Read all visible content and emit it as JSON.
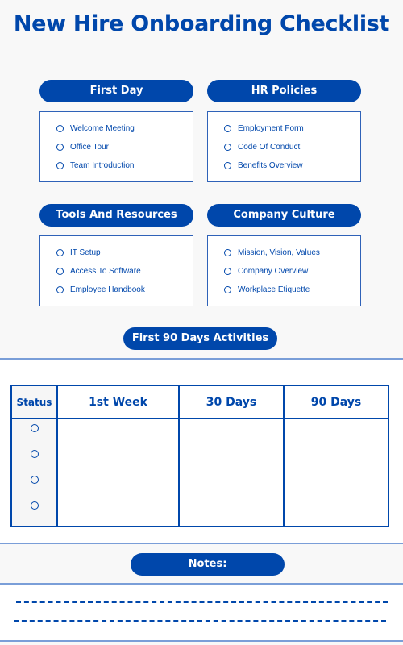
{
  "title": "New Hire Onboarding Checklist",
  "sections": [
    {
      "heading": "First Day",
      "items": [
        "Welcome Meeting",
        "Office Tour",
        "Team Introduction"
      ]
    },
    {
      "heading": "HR Policies",
      "items": [
        "Employment Form",
        "Code Of Conduct",
        "Benefits Overview"
      ]
    },
    {
      "heading": "Tools And Resources",
      "items": [
        "IT Setup",
        "Access To Software",
        "Employee Handbook"
      ]
    },
    {
      "heading": "Company Culture",
      "items": [
        "Mission, Vision, Values",
        "Company Overview",
        "Workplace Etiquette"
      ]
    }
  ],
  "activities": {
    "heading": "First 90 Days Activities",
    "columns": [
      "Status",
      "1st  Week",
      "30 Days",
      "90 Days"
    ],
    "status_rows": 4
  },
  "notes": {
    "heading": "Notes:",
    "lines": 2
  },
  "colors": {
    "brand_blue": "#0047ab",
    "background": "#f8f8f8"
  }
}
